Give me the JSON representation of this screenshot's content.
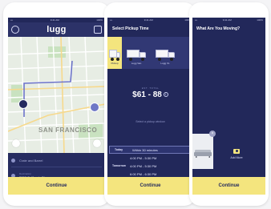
{
  "screen1": {
    "status_time": "9:41 AM",
    "status_signal": "•••",
    "status_battery": "100%",
    "logo": "lugg",
    "map_city_label": "SAN FRANCISCO",
    "route": {
      "pickup_placeholder": "Crate and Barrel",
      "destination_label": "Destination",
      "destination_value": "3058 California St"
    },
    "cta": "Continue"
  },
  "screen2": {
    "status_time": "9:41 AM",
    "status_signal": "•••",
    "status_battery": "100%",
    "title": "Select Pickup Time",
    "vehicles": [
      {
        "name": "Pickup",
        "selected": true
      },
      {
        "name": "Lugg Van",
        "selected": false
      },
      {
        "name": "Lugg XL",
        "selected": false
      }
    ],
    "price_label": "EST. TOTAL",
    "price": "$61 - 88",
    "hint": "Select a pickup window",
    "slots": [
      {
        "day": "Today",
        "time": "Within 30 minutes",
        "active": true
      },
      {
        "day": "",
        "time": "4:00 PM - 5:30 PM",
        "active": false
      },
      {
        "day": "Tomorrow",
        "time": "4:00 PM - 5:30 PM",
        "active": false
      },
      {
        "day": "",
        "time": "6:00 PM - 6:30 PM",
        "active": false
      }
    ],
    "cta": "Continue"
  },
  "screen3": {
    "status_time": "9:41 AM",
    "status_signal": "•••",
    "status_battery": "100%",
    "title": "What Are You Moving?",
    "add_more": "Add More",
    "cta": "Continue"
  },
  "colors": {
    "navy": "#22285a",
    "accent_yellow": "#f4e57e",
    "map_bg": "#e7ede4"
  }
}
